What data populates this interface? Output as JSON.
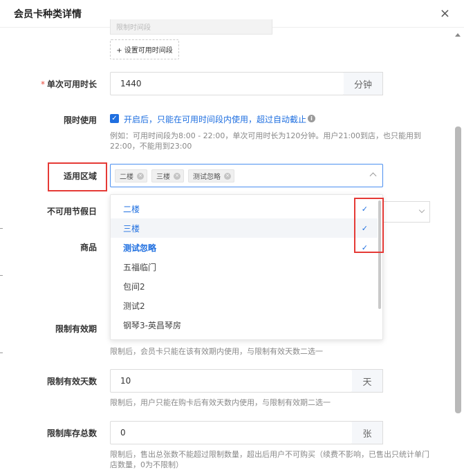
{
  "dialog": {
    "title": "会员卡种类详情",
    "close_label": "×"
  },
  "time_slot": {
    "faded_value": "限制时间段",
    "add_button": "+ 设置可用时间段"
  },
  "single_duration": {
    "required_mark": "*",
    "label": "单次可用时长",
    "value": "1440",
    "unit": "分钟"
  },
  "time_limit": {
    "label": "限时使用",
    "checked": true,
    "check_text": "开启后，只能在可用时间段内使用，超过自动截止",
    "info_icon": "i",
    "hint_line1": "例如：可用时间段为8:00 - 22:00，单次可用时长为120分钟。用户21:00到店，也只能用到",
    "hint_line2": "22:00，不能用到23:00"
  },
  "area": {
    "label": "适用区域",
    "tags": [
      {
        "label": "二楼"
      },
      {
        "label": "三楼"
      },
      {
        "label": "测试忽略"
      }
    ]
  },
  "dropdown": {
    "items": [
      {
        "label": "二楼",
        "selected": true,
        "hover": false
      },
      {
        "label": "三楼",
        "selected": true,
        "hover": true
      },
      {
        "label": "测试忽略",
        "selected": true,
        "hover": false
      },
      {
        "label": "五福临门",
        "selected": false,
        "hover": false
      },
      {
        "label": "包间2",
        "selected": false,
        "hover": false
      },
      {
        "label": "测试2",
        "selected": false,
        "hover": false
      },
      {
        "label": "钢琴3-英昌琴房",
        "selected": false,
        "hover": false
      }
    ],
    "check_glyph": "✓"
  },
  "holiday": {
    "label": "不可用节假日"
  },
  "goods": {
    "label": "商品"
  },
  "validity": {
    "label": "限制有效期",
    "hint": "限制后，会员卡只能在该有效期内使用，与限制有效天数二选一"
  },
  "valid_days": {
    "label": "限制有效天数",
    "value": "10",
    "unit": "天",
    "hint": "限制后，用户只能在购卡后有效天数内使用，与限制有效期二选一"
  },
  "stock": {
    "label": "限制库存总数",
    "value": "0",
    "unit": "张",
    "hint_line1": "限制后，售出总张数不能超过限制数量，超出后用户不可购买（续费不影响，已售出只统计单门",
    "hint_line2": "店数量，0为不限制）"
  },
  "colors": {
    "primary": "#1f6fe0",
    "annotation": "#e53935"
  }
}
